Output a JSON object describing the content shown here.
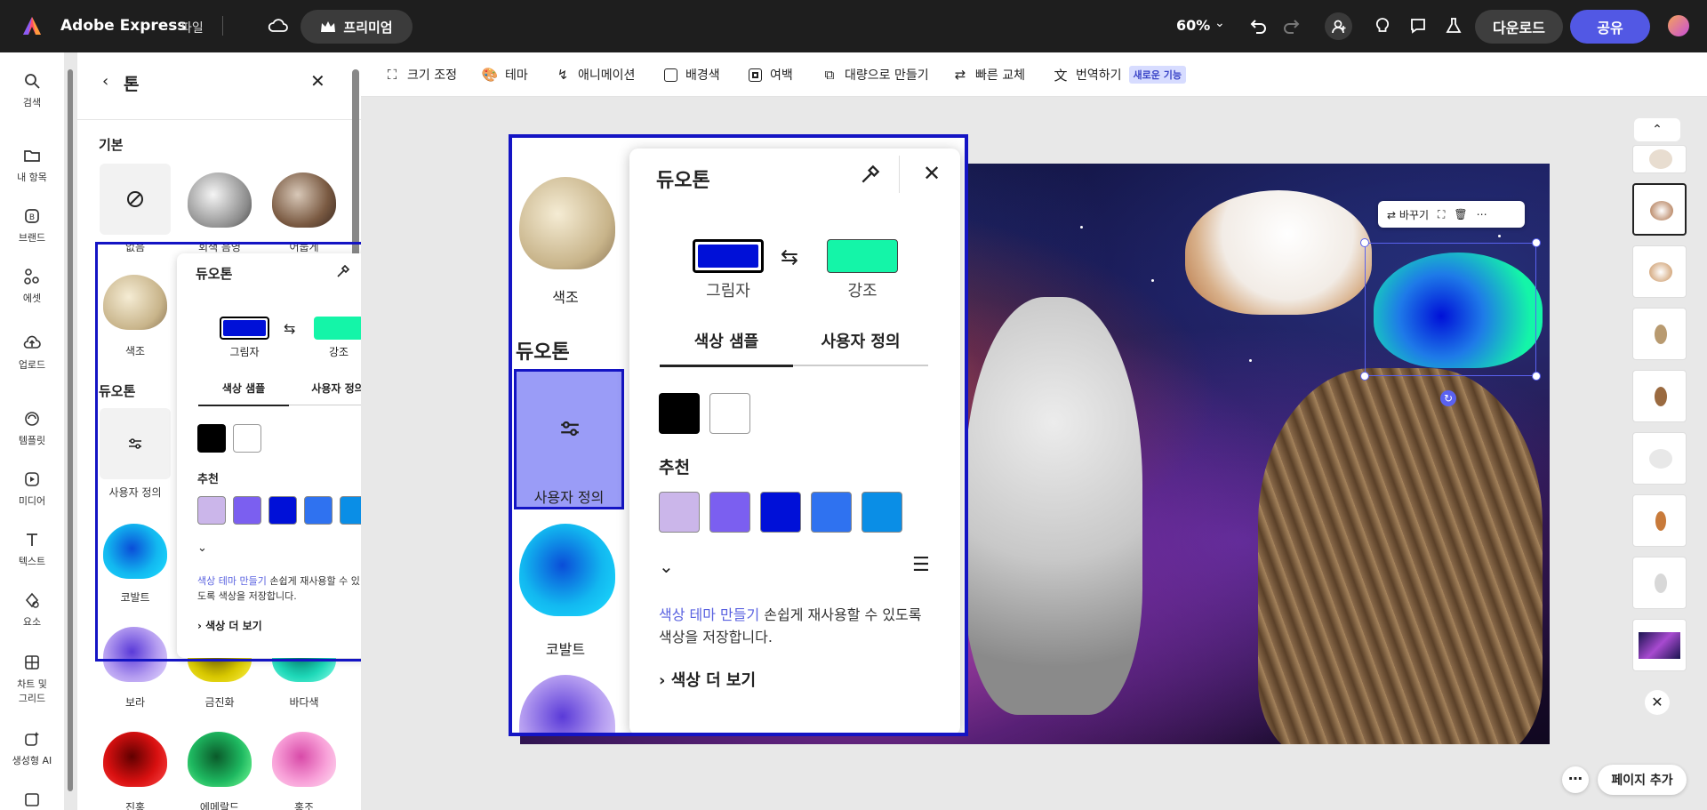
{
  "topbar": {
    "app_title": "Adobe Express",
    "file_menu": "파일",
    "premium": "프리미엄",
    "zoom": "60%",
    "download": "다운로드",
    "share": "공유"
  },
  "rail": {
    "items": [
      {
        "label": "검색",
        "icon": "search-icon"
      },
      {
        "label": "내 항목",
        "icon": "folder-icon"
      },
      {
        "label": "브랜드",
        "icon": "brand-icon"
      },
      {
        "label": "에셋",
        "icon": "assets-icon"
      },
      {
        "label": "업로드",
        "icon": "upload-icon"
      },
      {
        "label": "템플릿",
        "icon": "template-icon"
      },
      {
        "label": "미디어",
        "icon": "media-icon"
      },
      {
        "label": "텍스트",
        "icon": "text-icon"
      },
      {
        "label": "요소",
        "icon": "elements-icon"
      },
      {
        "label": "차트 및",
        "label2": "그리드",
        "icon": "chart-grid-icon"
      },
      {
        "label": "생성형 AI",
        "icon": "generative-ai-icon"
      }
    ]
  },
  "panel": {
    "title": "톤",
    "basic_label": "기본",
    "duotone_label": "듀오톤",
    "basic_items": [
      {
        "label": "없음"
      },
      {
        "label": "회색 음영"
      },
      {
        "label": "어둡게"
      }
    ],
    "tone_label": "색조",
    "custom_label": "사용자 정의",
    "cobalt_label": "코발트",
    "row_labels": [
      "보라",
      "금진화",
      "바다색"
    ],
    "bottom_labels": [
      "진홍",
      "에메랄드",
      "홍조"
    ]
  },
  "duotone_popup": {
    "title": "듀오톤",
    "shadow_label": "그림자",
    "highlight_label": "강조",
    "shadow_color": "#0010d8",
    "highlight_color": "#14f5a8",
    "tab_samples": "색상 샘플",
    "tab_custom": "사용자 정의",
    "recommend_label": "추천",
    "recommended_colors": [
      "#cbb6ea",
      "#7b5ff0",
      "#0010d8",
      "#2f72f0",
      "#0a8ee6"
    ],
    "theme_link": "색상 테마 만들기",
    "theme_text": " 손쉽게 재사용할 수 있도록 색상을 저장합니다.",
    "more_colors": "색상 더 보기"
  },
  "toolbar": {
    "items": [
      {
        "label": "크기 조정",
        "icon": "resize-icon"
      },
      {
        "label": "테마",
        "icon": "palette-icon"
      },
      {
        "label": "애니메이션",
        "icon": "animation-icon"
      },
      {
        "label": "배경색",
        "icon": "background-color-icon"
      },
      {
        "label": "여백",
        "icon": "margin-icon"
      },
      {
        "label": "대량으로 만들기",
        "icon": "bulk-create-icon"
      },
      {
        "label": "빠른 교체",
        "icon": "quick-replace-icon"
      },
      {
        "label": "번역하기",
        "icon": "translate-icon"
      }
    ],
    "new_badge": "새로운 기능"
  },
  "selection": {
    "replace_label": "바꾸기"
  },
  "pages": {
    "add_page": "페이지 추가"
  }
}
